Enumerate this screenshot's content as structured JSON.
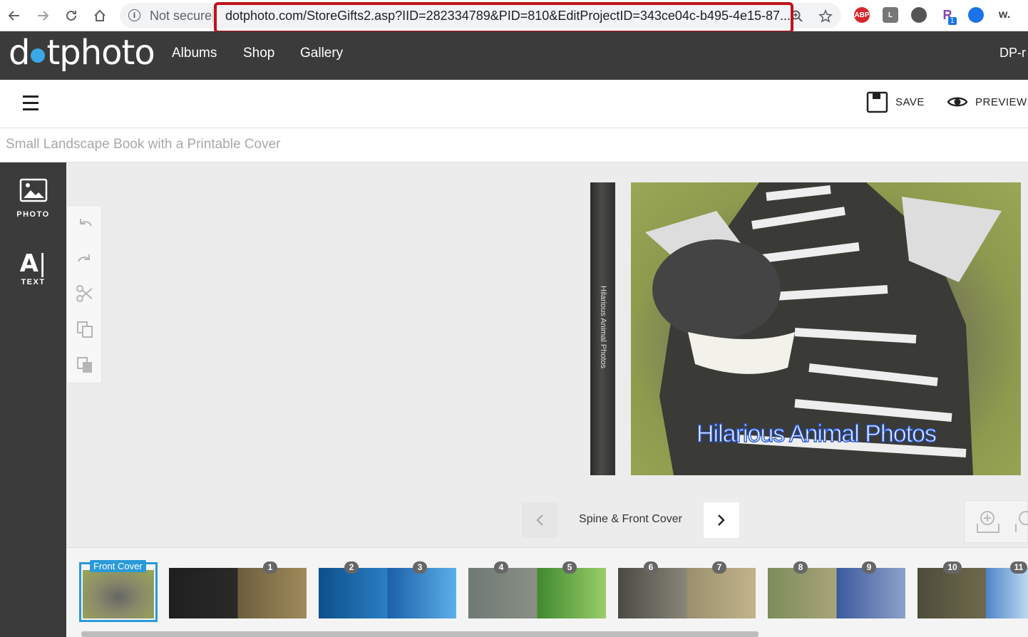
{
  "browser": {
    "security_label": "Not secure",
    "url": "dotphoto.com/StoreGifts2.asp?IID=282334789&PID=810&EditProjectID=343ce04c-b495-4e15-87...",
    "extensions": [
      "ABP",
      "L",
      "",
      "R",
      "",
      "w."
    ],
    "extension_badge": "1"
  },
  "site": {
    "logo_text_1": "d",
    "logo_text_2": "tphoto",
    "nav": [
      "Albums",
      "Shop",
      "Gallery"
    ],
    "user": "DP-r"
  },
  "toolbar": {
    "save_label": "SAVE",
    "preview_label": "PREVIEW"
  },
  "project": {
    "title": "Small Landscape Book with a Printable Cover"
  },
  "tools": {
    "photo_label": "PHOTO",
    "text_label": "TEXT",
    "text_icon": "A"
  },
  "editor": {
    "spine_text": "Hilarious Animal Photos",
    "cover_title": "Hilarious Animal Photos",
    "page_label": "Spine & Front Cover"
  },
  "filmstrip": {
    "first_label": "Front Cover",
    "spreads": [
      {
        "left": "",
        "right": "1"
      },
      {
        "left": "2",
        "right": "3"
      },
      {
        "left": "4",
        "right": "5"
      },
      {
        "left": "6",
        "right": "7"
      },
      {
        "left": "8",
        "right": "9"
      },
      {
        "left": "10",
        "right": "11"
      }
    ]
  },
  "colors": {
    "header_bg": "#3b3b3b",
    "accent": "#2a9ad8",
    "url_highlight": "#c0111a"
  }
}
